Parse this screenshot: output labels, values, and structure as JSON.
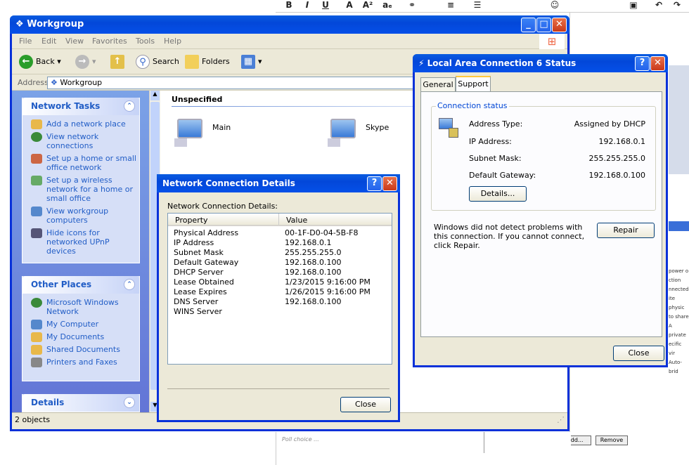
{
  "bg": {
    "toolbar_glyphs": [
      "B",
      "I",
      "U",
      "A",
      "A²",
      "aₑ"
    ],
    "poll_text": "Poll choice ...",
    "add_label": "Add...",
    "remove_label": "Remove",
    "side_snippets": [
      "power o",
      "ction",
      "nnected",
      "ite physic",
      "to share",
      "A private",
      "ecific vir",
      "Auto-brid"
    ]
  },
  "explorer": {
    "title": "Workgroup",
    "menu": [
      "File",
      "Edit",
      "View",
      "Favorites",
      "Tools",
      "Help"
    ],
    "toolbar": {
      "back": "Back",
      "search": "Search",
      "folders": "Folders"
    },
    "address_label": "Address",
    "address_value": "Workgroup",
    "group_header": "Unspecified",
    "items": [
      "Main",
      "Skype"
    ],
    "status": "2 objects",
    "network_tasks": {
      "title": "Network Tasks",
      "links": [
        "Add a network place",
        "View network connections",
        "Set up a home or small office network",
        "Set up a wireless network for a home or small office",
        "View workgroup computers",
        "Hide icons for networked UPnP devices"
      ]
    },
    "other_places": {
      "title": "Other Places",
      "links": [
        "Microsoft Windows Network",
        "My Computer",
        "My Documents",
        "Shared Documents",
        "Printers and Faxes"
      ]
    },
    "details": {
      "title": "Details"
    }
  },
  "details_dialog": {
    "title": "Network Connection Details",
    "caption": "Network Connection Details:",
    "columns": [
      "Property",
      "Value"
    ],
    "rows": [
      [
        "Physical Address",
        "00-1F-D0-04-5B-F8"
      ],
      [
        "IP Address",
        "192.168.0.1"
      ],
      [
        "Subnet Mask",
        "255.255.255.0"
      ],
      [
        "Default Gateway",
        "192.168.0.100"
      ],
      [
        "DHCP Server",
        "192.168.0.100"
      ],
      [
        "Lease Obtained",
        "1/23/2015 9:16:00 PM"
      ],
      [
        "Lease Expires",
        "1/26/2015 9:16:00 PM"
      ],
      [
        "DNS Server",
        "192.168.0.100"
      ],
      [
        "WINS Server",
        ""
      ]
    ],
    "close_label": "Close"
  },
  "status_dialog": {
    "title": "Local Area Connection 6 Status",
    "tabs": [
      "General",
      "Support"
    ],
    "group_title": "Connection status",
    "fields": [
      [
        "Address Type:",
        "Assigned by DHCP"
      ],
      [
        "IP Address:",
        "192.168.0.1"
      ],
      [
        "Subnet Mask:",
        "255.255.255.0"
      ],
      [
        "Default Gateway:",
        "192.168.0.100"
      ]
    ],
    "details_label": "Details...",
    "message": "Windows did not detect problems with this connection. If you cannot connect, click Repair.",
    "repair_label": "Repair",
    "close_label": "Close"
  }
}
